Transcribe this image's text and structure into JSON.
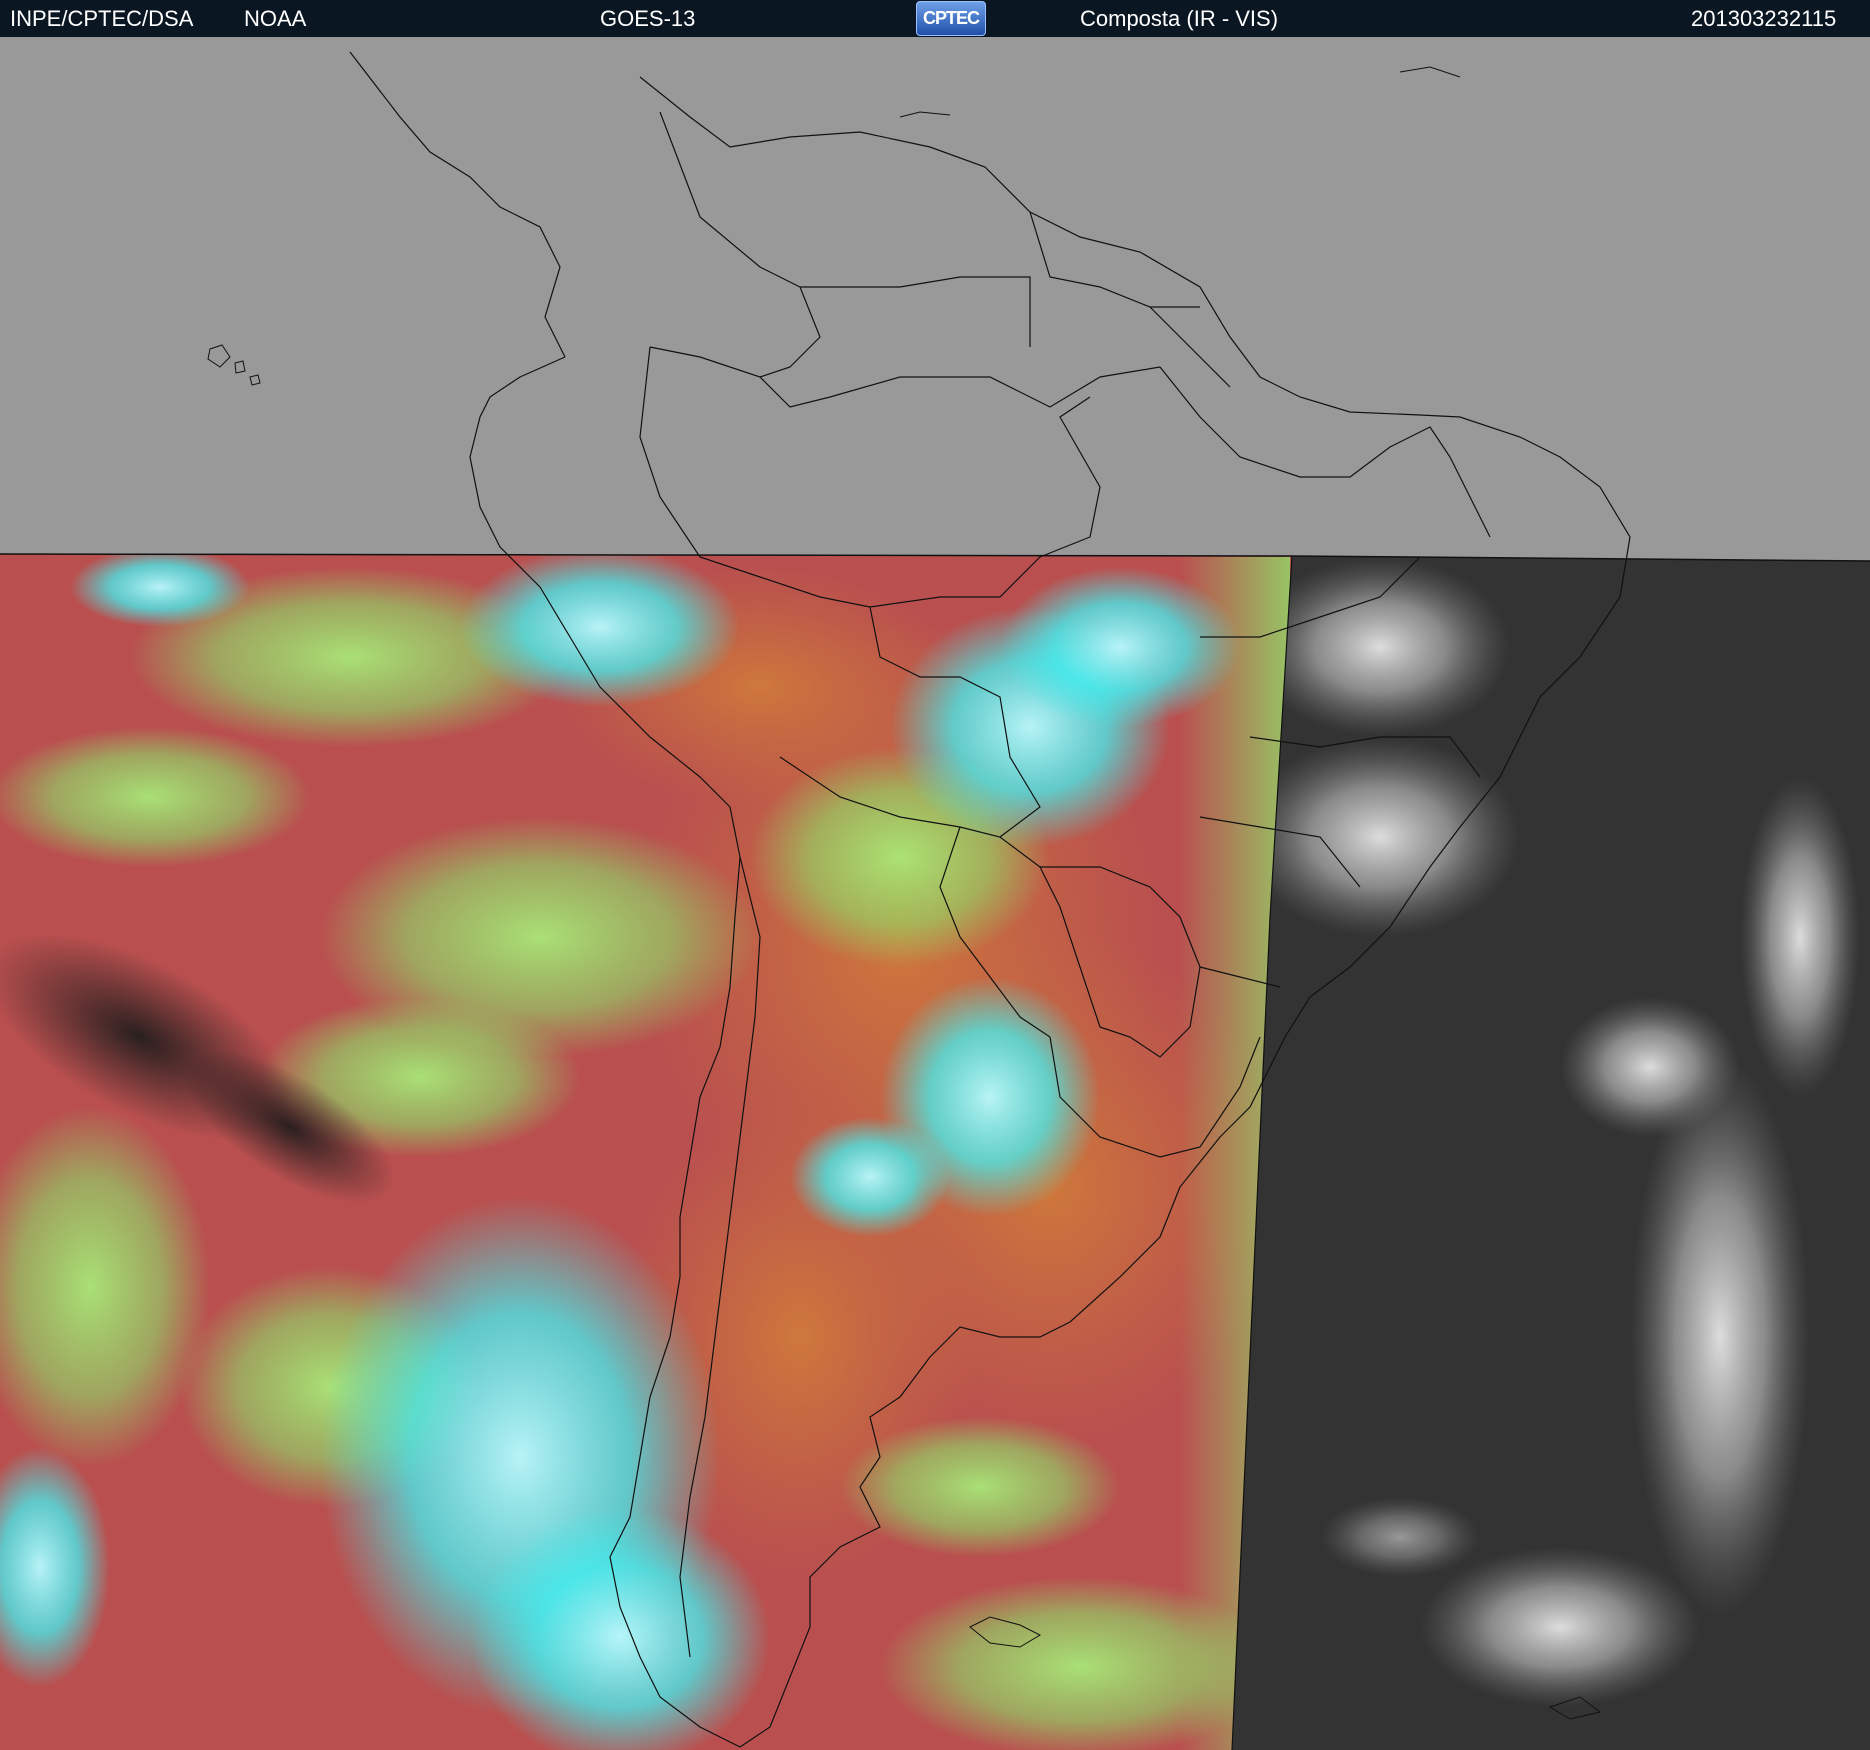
{
  "header": {
    "org": "INPE/CPTEC/DSA",
    "agency": "NOAA",
    "satellite": "GOES-13",
    "logo_text": "CPTEC",
    "product": "Composta (IR - VIS)",
    "timestamp": "201303232115"
  },
  "colors": {
    "header_bg": "#0b1623",
    "no_data_gray": "#999999",
    "ir_red": "#b9504f",
    "ir_orange": "#c8703e",
    "cloud_green": "#8fe06a",
    "cloud_cyan": "#44f0f2",
    "vis_dark": "#333333",
    "border_line": "#111111"
  }
}
